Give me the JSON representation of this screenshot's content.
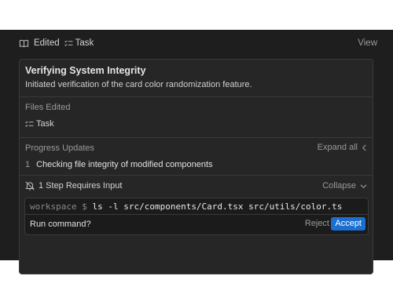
{
  "header": {
    "edited_label": "Edited",
    "task_label": "Task",
    "view_label": "View"
  },
  "card": {
    "title": "Verifying System Integrity",
    "subtitle": "Initiated verification of the card color randomization feature.",
    "files": {
      "label": "Files Edited",
      "item": "Task"
    },
    "progress": {
      "label": "Progress Updates",
      "expand_label": "Expand all",
      "steps": [
        {
          "number": "1",
          "text": "Checking file integrity of modified components"
        }
      ]
    },
    "input": {
      "label": "1 Step Requires Input",
      "collapse_label": "Collapse",
      "prompt": "workspace $",
      "command": "ls -l src/components/Card.tsx src/utils/color.ts",
      "question": "Run command?",
      "reject_label": "Reject",
      "accept_label": "Accept"
    }
  },
  "colors": {
    "background": "#1e1e1e",
    "card": "#262626",
    "accent": "#1a6fd1"
  },
  "icons": {
    "edited": "book-open-icon",
    "task": "checklist-icon",
    "expand": "chevron-left-icon",
    "requires_input": "bell-icon",
    "collapse": "chevron-down-icon"
  }
}
